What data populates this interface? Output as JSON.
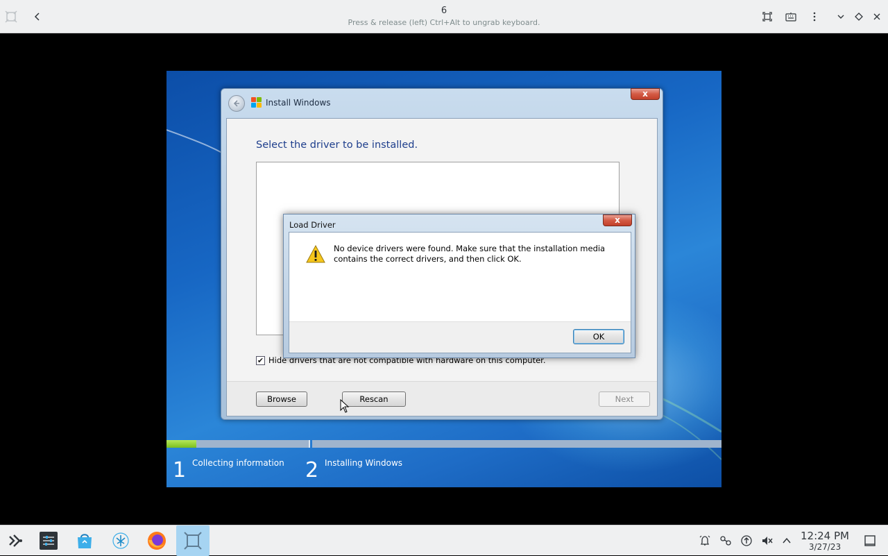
{
  "viewer": {
    "title": "6",
    "subtitle": "Press & release (left) Ctrl+Alt to ungrab keyboard.",
    "icons": [
      "app-icon",
      "back-icon",
      "fullscreen-icon",
      "keyboard-icon",
      "menu-icon",
      "minimize-icon",
      "maximize-icon",
      "close-icon"
    ]
  },
  "install_window": {
    "title": "Install Windows",
    "close_label": "x",
    "heading": "Select the driver to be installed.",
    "hide_checkbox": {
      "checked": true,
      "mark": "✔",
      "label": "Hide drivers that are not compatible with hardware on this computer."
    },
    "buttons": {
      "browse": "Browse",
      "rescan": "Rescan",
      "next": "Next"
    }
  },
  "load_driver": {
    "title": "Load Driver",
    "close_label": "x",
    "message": "No device drivers were found. Make sure that the installation media contains the correct drivers, and then click OK.",
    "ok": "OK"
  },
  "setup_progress": {
    "progress": 0.21,
    "steps": [
      {
        "number": "1",
        "label": "Collecting information"
      },
      {
        "number": "2",
        "label": "Installing Windows"
      }
    ]
  },
  "taskbar": {
    "apps": [
      "launcher-icon",
      "settings-icon",
      "store-icon",
      "files-icon",
      "firefox-icon",
      "vm-viewer-icon"
    ],
    "tray": [
      "notification-icon",
      "network-icon",
      "updates-icon",
      "volume-muted-icon",
      "expand-tray-icon"
    ],
    "time": "12:24 PM",
    "date": "3/27/23"
  }
}
